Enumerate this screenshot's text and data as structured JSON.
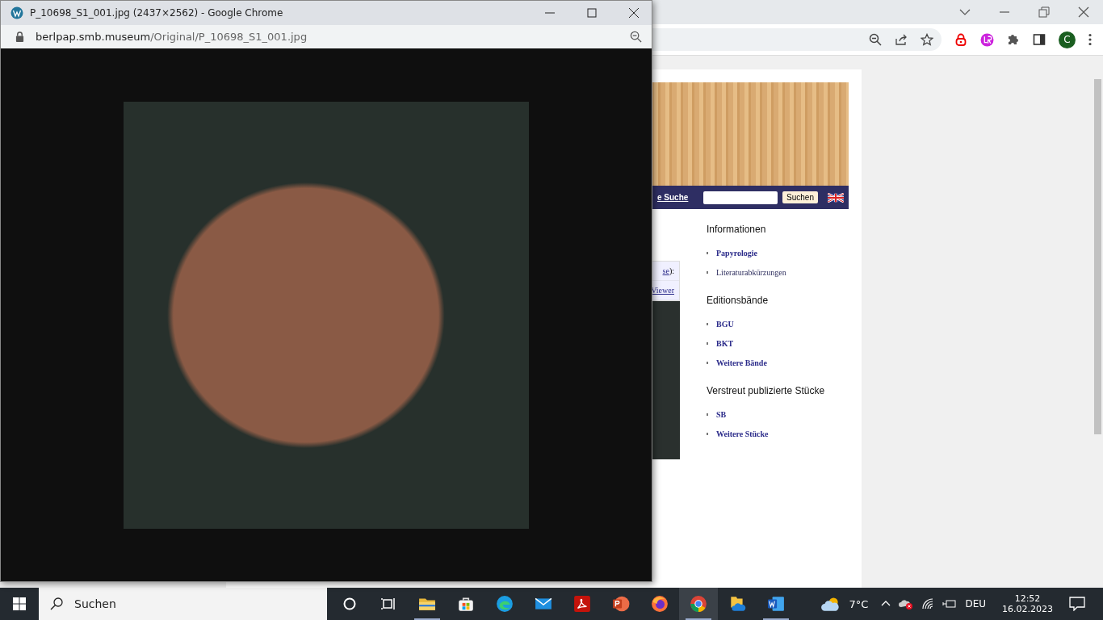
{
  "popup": {
    "title": "P_10698_S1_001.jpg (2437×2562) - Google Chrome",
    "url_host": "berlpap.smb.museum",
    "url_path": "/Original/P_10698_S1_001.jpg"
  },
  "browser": {
    "profile_initial": "C"
  },
  "page": {
    "nav_link": "e Suche",
    "search_button": "Suchen",
    "content_link": "se",
    "content_text": "):",
    "viewer_link": "Viewer"
  },
  "sidebar": [
    {
      "heading": "Informationen",
      "links": [
        {
          "label": "Papyrologie",
          "bold": true
        },
        {
          "label": "Literaturabkürzungen",
          "bold": false
        }
      ]
    },
    {
      "heading": "Editionsbände",
      "links": [
        {
          "label": "BGU",
          "bold": true
        },
        {
          "label": "BKT",
          "bold": true
        },
        {
          "label": "Weitere Bände",
          "bold": true
        }
      ]
    },
    {
      "heading": "Verstreut publizierte Stücke",
      "links": [
        {
          "label": "SB",
          "bold": true
        },
        {
          "label": "Weitere Stücke",
          "bold": true
        }
      ]
    }
  ],
  "taskbar": {
    "search_placeholder": "Suchen",
    "apps": [
      {
        "kind": "taskview",
        "running": false,
        "selected": false
      },
      {
        "kind": "explorer",
        "running": true,
        "selected": false
      },
      {
        "kind": "store",
        "running": false,
        "selected": false
      },
      {
        "kind": "edge",
        "running": false,
        "selected": false
      },
      {
        "kind": "mail",
        "running": false,
        "selected": false
      },
      {
        "kind": "pdf",
        "running": false,
        "selected": false
      },
      {
        "kind": "powerpoint",
        "running": false,
        "selected": false
      },
      {
        "kind": "firefox",
        "running": false,
        "selected": false
      },
      {
        "kind": "chrome",
        "running": true,
        "selected": true
      },
      {
        "kind": "files",
        "running": false,
        "selected": false
      },
      {
        "kind": "word",
        "running": true,
        "selected": false
      }
    ],
    "temperature": "7°C",
    "language": "DEU",
    "time": "12:52",
    "date": "16.02.2023"
  }
}
